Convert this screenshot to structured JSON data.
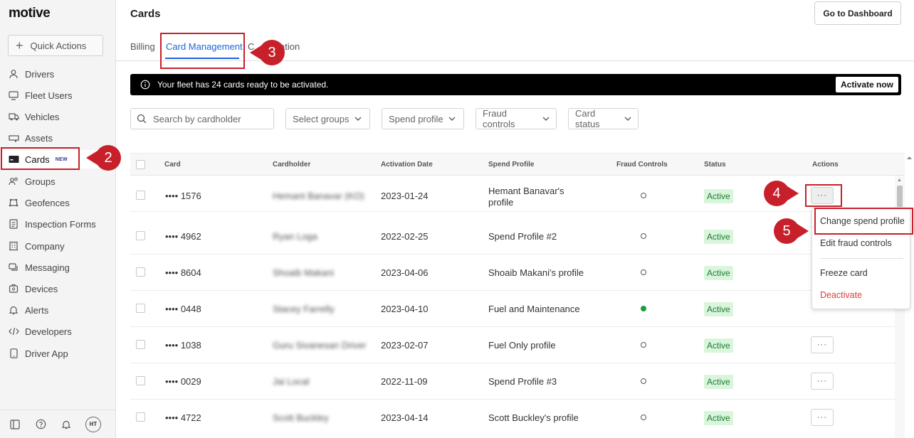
{
  "app": {
    "logo": "motive",
    "page_title": "Cards",
    "dashboard_button": "Go to Dashboard"
  },
  "sidebar": {
    "quick_actions": "Quick Actions",
    "items": [
      {
        "label": "Drivers",
        "icon": "person-icon"
      },
      {
        "label": "Fleet Users",
        "icon": "monitor-icon"
      },
      {
        "label": "Vehicles",
        "icon": "truck-icon"
      },
      {
        "label": "Assets",
        "icon": "trailer-icon"
      },
      {
        "label": "Cards",
        "icon": "card-icon",
        "badge": "NEW"
      },
      {
        "label": "Groups",
        "icon": "users-icon"
      },
      {
        "label": "Geofences",
        "icon": "geofence-icon"
      },
      {
        "label": "Inspection Forms",
        "icon": "document-icon"
      },
      {
        "label": "Company",
        "icon": "building-icon"
      },
      {
        "label": "Messaging",
        "icon": "chat-icon"
      },
      {
        "label": "Devices",
        "icon": "device-icon"
      },
      {
        "label": "Alerts",
        "icon": "bell-icon"
      },
      {
        "label": "Developers",
        "icon": "code-icon"
      },
      {
        "label": "Driver App",
        "icon": "phone-icon"
      }
    ],
    "footer": {
      "avatar_initials": "HT"
    }
  },
  "tabs": [
    {
      "label": "Billing"
    },
    {
      "label": "Card Management"
    },
    {
      "label": "Configuration",
      "visible_fragment": "C",
      "visible_tail": "ation"
    }
  ],
  "banner": {
    "message": "Your fleet has 24 cards ready to be activated.",
    "button": "Activate now"
  },
  "filters": {
    "search_placeholder": "Search by cardholder",
    "dropdowns": [
      "Select groups",
      "Spend profile",
      "Fraud controls",
      "Card status"
    ]
  },
  "table": {
    "headers": [
      "Card",
      "Cardholder",
      "Activation Date",
      "Spend Profile",
      "Fraud Controls",
      "Status",
      "Actions"
    ],
    "rows": [
      {
        "card": "•••• 1576",
        "cardholder": "Hemant Banavar (KO)",
        "date": "2023-01-24",
        "profile_line1": "Hemant Banavar's",
        "profile_line2": "profile",
        "fraud": false,
        "status": "Active"
      },
      {
        "card": "•••• 4962",
        "cardholder": "Ryan Loga",
        "date": "2022-02-25",
        "profile_line1": "Spend Profile #2",
        "profile_line2": "",
        "fraud": false,
        "status": "Active"
      },
      {
        "card": "•••• 8604",
        "cardholder": "Shoaib Makani",
        "date": "2023-04-06",
        "profile_line1": "Shoaib Makani's profile",
        "profile_line2": "",
        "fraud": false,
        "status": "Active"
      },
      {
        "card": "•••• 0448",
        "cardholder": "Stacey Farrelly",
        "date": "2023-04-10",
        "profile_line1": "Fuel and Maintenance",
        "profile_line2": "",
        "fraud": true,
        "status": "Active"
      },
      {
        "card": "•••• 1038",
        "cardholder": "Guru Sivanesan Driver",
        "date": "2023-02-07",
        "profile_line1": "Fuel Only profile",
        "profile_line2": "",
        "fraud": false,
        "status": "Active"
      },
      {
        "card": "•••• 0029",
        "cardholder": "Jai Local",
        "date": "2022-11-09",
        "profile_line1": "Spend Profile #3",
        "profile_line2": "",
        "fraud": false,
        "status": "Active"
      },
      {
        "card": "•••• 4722",
        "cardholder": "Scott Buckley",
        "date": "2023-04-14",
        "profile_line1": "Scott Buckley's profile",
        "profile_line2": "",
        "fraud": false,
        "status": "Active"
      }
    ],
    "more_label": "···"
  },
  "actions_menu": {
    "items": [
      "Change spend profile",
      "Edit fraud controls",
      "Freeze card",
      "Deactivate"
    ]
  },
  "annotations": {
    "markers": [
      "2",
      "3",
      "4",
      "5"
    ]
  },
  "colors": {
    "accent": "#1a66d9",
    "annotation": "#c8202a",
    "active_bg": "#d9f5dc",
    "active_text": "#1e7a33",
    "danger": "#e53935",
    "fraud_on": "#1f9d3a"
  }
}
